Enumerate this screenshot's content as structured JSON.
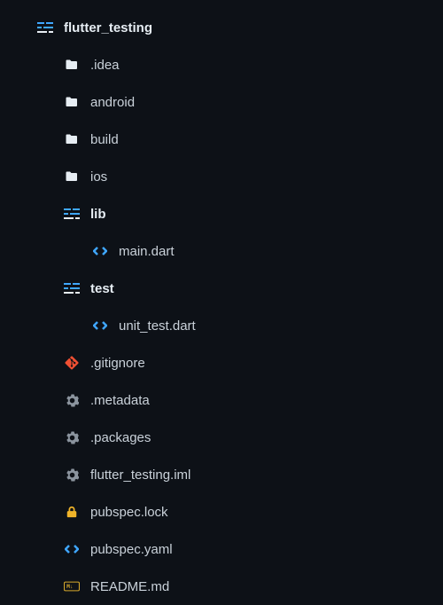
{
  "root": {
    "name": "flutter_testing"
  },
  "items": [
    {
      "label": ".idea",
      "icon": "folder",
      "indent": 1
    },
    {
      "label": "android",
      "icon": "folder",
      "indent": 1
    },
    {
      "label": "build",
      "icon": "folder",
      "indent": 1
    },
    {
      "label": "ios",
      "icon": "folder",
      "indent": 1
    },
    {
      "label": "lib",
      "icon": "project",
      "indent": 1,
      "bold": true
    },
    {
      "label": "main.dart",
      "icon": "code",
      "indent": 2
    },
    {
      "label": "test",
      "icon": "project",
      "indent": 1,
      "bold": true
    },
    {
      "label": "unit_test.dart",
      "icon": "code",
      "indent": 2
    },
    {
      "label": ".gitignore",
      "icon": "git",
      "indent": 1
    },
    {
      "label": ".metadata",
      "icon": "gear",
      "indent": 1
    },
    {
      "label": ".packages",
      "icon": "gear",
      "indent": 1
    },
    {
      "label": "flutter_testing.iml",
      "icon": "gear",
      "indent": 1
    },
    {
      "label": "pubspec.lock",
      "icon": "lock",
      "indent": 1
    },
    {
      "label": "pubspec.yaml",
      "icon": "code",
      "indent": 1
    },
    {
      "label": "README.md",
      "icon": "md",
      "indent": 1
    }
  ]
}
